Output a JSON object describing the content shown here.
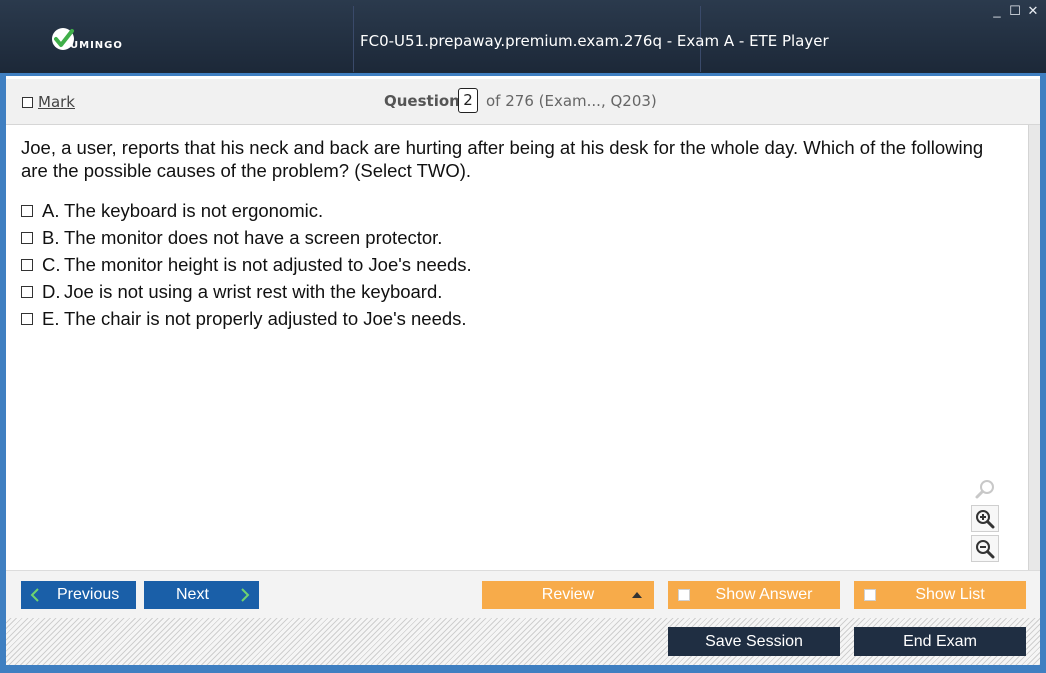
{
  "app": {
    "logo_text": "UMINGO",
    "window_title": "FC0-U51.prepaway.premium.exam.276q - Exam A - ETE Player",
    "brand_color": "#3f7fc1"
  },
  "window_controls": {
    "minimize": "_",
    "maximize": "☐",
    "close": "✕"
  },
  "header": {
    "mark_label": "Mark",
    "question_label": "Question",
    "question_number": "2",
    "question_of": "of 276 (Exam..., Q203)"
  },
  "question": {
    "text": "Joe, a user, reports that his neck and back are hurting after being at his desk for the whole day. Which of the following are the possible causes of the problem? (Select TWO).",
    "options": [
      {
        "letter": "A.",
        "text": "The keyboard is not ergonomic."
      },
      {
        "letter": "B.",
        "text": "The monitor does not have a screen protector."
      },
      {
        "letter": "C.",
        "text": "The monitor height is not adjusted to Joe's needs."
      },
      {
        "letter": "D.",
        "text": "Joe is not using a wrist rest with the keyboard."
      },
      {
        "letter": "E.",
        "text": "The chair is not properly adjusted to Joe's needs."
      }
    ]
  },
  "zoom_icons": [
    "search-icon",
    "zoom-in-icon",
    "zoom-out-icon"
  ],
  "nav": {
    "previous": "Previous",
    "next": "Next",
    "review": "Review",
    "show_answer": "Show Answer",
    "show_list": "Show List",
    "nav_color": "#1a5fa8",
    "action_color": "#f7ab4a"
  },
  "footer": {
    "save_session": "Save Session",
    "end_exam": "End Exam",
    "button_color": "#1f2e42"
  }
}
